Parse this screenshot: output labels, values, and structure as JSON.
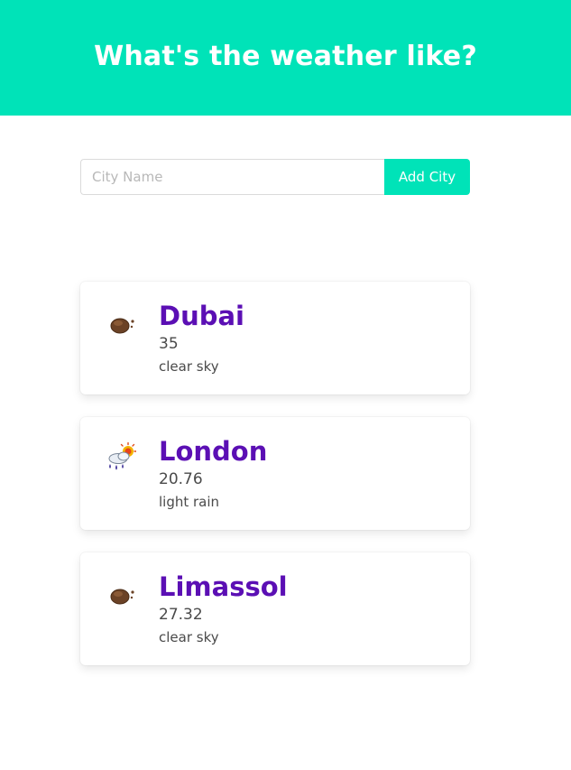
{
  "header": {
    "title": "What's the weather like?",
    "background_color": "#00e3b8"
  },
  "form": {
    "input_placeholder": "City Name",
    "input_value": "",
    "button_label": "Add City"
  },
  "cards": [
    {
      "city": "Dubai",
      "temp": "35",
      "description": "clear sky",
      "icon": "clear-sky-icon"
    },
    {
      "city": "London",
      "temp": "20.76",
      "description": "light rain",
      "icon": "light-rain-icon"
    },
    {
      "city": "Limassol",
      "temp": "27.32",
      "description": "clear sky",
      "icon": "clear-sky-icon"
    }
  ],
  "colors": {
    "accent": "#00e3b8",
    "city_name": "#5b0fb4",
    "text": "#4a4a4a"
  }
}
